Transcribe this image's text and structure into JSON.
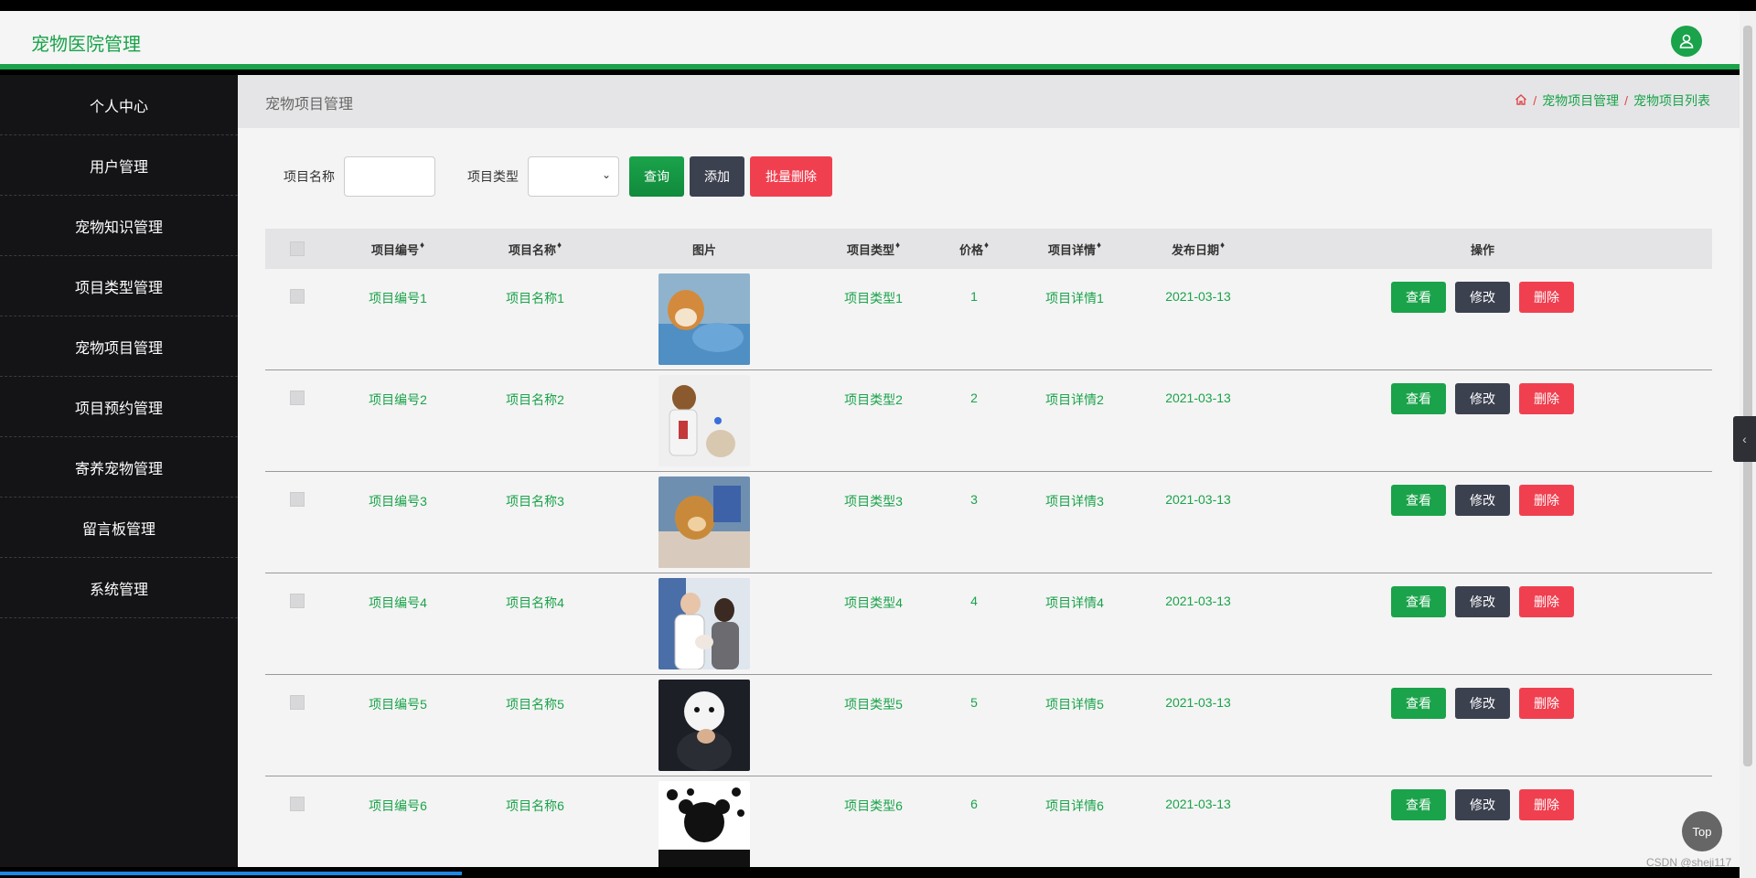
{
  "header": {
    "title": "宠物医院管理",
    "user_icon": "user-icon"
  },
  "sidebar": {
    "items": [
      {
        "label": "个人中心"
      },
      {
        "label": "用户管理"
      },
      {
        "label": "宠物知识管理"
      },
      {
        "label": "项目类型管理"
      },
      {
        "label": "宠物项目管理"
      },
      {
        "label": "项目预约管理"
      },
      {
        "label": "寄养宠物管理"
      },
      {
        "label": "留言板管理"
      },
      {
        "label": "系统管理"
      }
    ]
  },
  "page": {
    "title": "宠物项目管理",
    "breadcrumb": {
      "home_icon": "home-icon",
      "crumb1": "宠物项目管理",
      "crumb2": "宠物项目列表"
    }
  },
  "search": {
    "name_label": "项目名称",
    "name_value": "",
    "type_label": "项目类型",
    "type_value": "",
    "query_label": "查询",
    "add_label": "添加",
    "batch_delete_label": "批量删除"
  },
  "table": {
    "headers": [
      "项目编号",
      "项目名称",
      "图片",
      "项目类型",
      "价格",
      "项目详情",
      "发布日期",
      "操作"
    ],
    "rows": [
      {
        "code": "项目编号1",
        "name": "项目名称1",
        "type": "项目类型1",
        "price": "1",
        "detail": "项目详情1",
        "date": "2021-03-13"
      },
      {
        "code": "项目编号2",
        "name": "项目名称2",
        "type": "项目类型2",
        "price": "2",
        "detail": "项目详情2",
        "date": "2021-03-13"
      },
      {
        "code": "项目编号3",
        "name": "项目名称3",
        "type": "项目类型3",
        "price": "3",
        "detail": "项目详情3",
        "date": "2021-03-13"
      },
      {
        "code": "项目编号4",
        "name": "项目名称4",
        "type": "项目类型4",
        "price": "4",
        "detail": "项目详情4",
        "date": "2021-03-13"
      },
      {
        "code": "项目编号5",
        "name": "项目名称5",
        "type": "项目类型5",
        "price": "5",
        "detail": "项目详情5",
        "date": "2021-03-13"
      },
      {
        "code": "项目编号6",
        "name": "项目名称6",
        "type": "项目类型6",
        "price": "6",
        "detail": "项目详情6",
        "date": "2021-03-13"
      }
    ],
    "actions": {
      "view": "查看",
      "edit": "修改",
      "delete": "删除"
    }
  },
  "top_button": "Top",
  "watermark": "CSDN @sheji117",
  "colors": {
    "accent": "#1aa34a",
    "dark": "#3c4150",
    "danger": "#f04050",
    "sidebar": "#141417"
  }
}
